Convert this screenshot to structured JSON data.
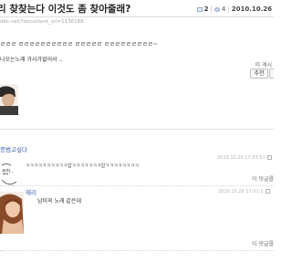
{
  "post": {
    "title": "리 찾찾는다 이것도 좀 찾아줄래?",
    "comment_count": "2",
    "view_count": "4",
    "date": "2010.10.26",
    "url": "dbs.net/?document_srl=1136188",
    "body_line1": "ㄹㄹㄹ ㄹㄹㄹㄹㄹㄹㄹㄹㄹㄹ ㄹㄹㄹㄹㄹ ㄹㄹㄹㄹㄹㄹㄹㄹㄹ~",
    "body_line2": "나오는노래 가사가없어서 ..",
    "recommend_count_label": "이 게시",
    "recommend_button_label": "추천"
  },
  "comments": [
    {
      "author": "종범고싶다",
      "time": "2010.10.26 17:33:51",
      "text": "ㅋㅋㅋㅋㅋㅋㅋㅋㅋㅋ압ㅋㅋㅋㅋㅋㅋㅋ압ㅋㅋㅋㅋㅋㅋㅋㅋ",
      "reply_label": "이 댓글를"
    },
    {
      "author": "헤리",
      "time": "2010.10.26 17:01:2",
      "text": "남미꼭 노래 같은데",
      "reply_label": "이 댓글를"
    }
  ],
  "icons": {
    "comment": "comment-icon",
    "view": "person-icon",
    "action": "square-icon"
  },
  "colors": {
    "author_link": "#3a5fa8",
    "muted": "#b4b4b4"
  }
}
